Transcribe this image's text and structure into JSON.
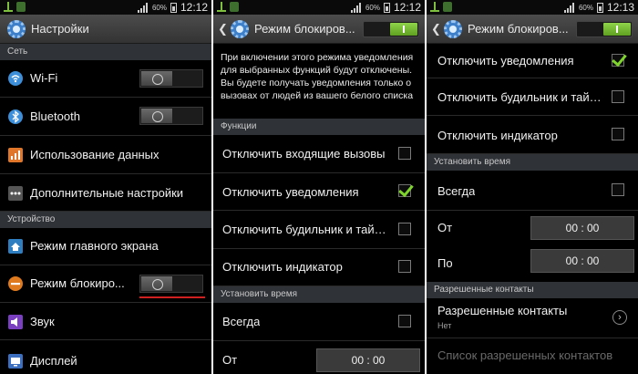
{
  "status": {
    "screen1": {
      "battery": "60%",
      "time": "12:12"
    },
    "screen2": {
      "battery": "60%",
      "time": "12:12"
    },
    "screen3": {
      "battery": "60%",
      "time": "12:13"
    }
  },
  "screen1": {
    "title": "Настройки",
    "section_network": "Сеть",
    "wifi_label": "Wi-Fi",
    "bluetooth_label": "Bluetooth",
    "data_usage_label": "Использование данных",
    "more_settings_label": "Дополнительные настройки",
    "section_device": "Устройство",
    "home_screen_label": "Режим главного экрана",
    "blocking_mode_label": "Режим блокиро...",
    "sound_label": "Звук",
    "display_label": "Дисплей",
    "toggles": {
      "wifi": false,
      "bluetooth": false,
      "blocking_mode": false
    }
  },
  "screen2": {
    "title": "Режим блокиров...",
    "description": "При включении этого режима уведомления для выбранных функций будут отключены. Вы будете получать уведомления только о вызовах от людей из вашего белого списка",
    "section_functions": "Функции",
    "opt_incoming_calls": "Отключить входящие вызовы",
    "opt_notifications": "Отключить уведомления",
    "opt_alarm": "Отключить будильник и таймер",
    "opt_indicator": "Отключить индикатор",
    "section_time": "Установить время",
    "always_label": "Всегда",
    "from_label": "От",
    "from_value": "00 : 00",
    "checked": {
      "incoming_calls": false,
      "notifications": true,
      "alarm": false,
      "indicator": false,
      "always": false
    }
  },
  "screen3": {
    "title": "Режим блокиров...",
    "opt_notifications": "Отключить уведомления",
    "opt_alarm": "Отключить будильник и таймер",
    "opt_indicator": "Отключить индикатор",
    "section_time": "Установить время",
    "always_label": "Всегда",
    "from_label": "От",
    "from_value": "00 : 00",
    "to_label": "По",
    "to_value": "00 : 00",
    "section_contacts": "Разрешенные контакты",
    "allowed_contacts_label": "Разрешенные контакты",
    "allowed_contacts_value": "Нет",
    "allowed_list_label": "Список разрешенных контактов",
    "checked": {
      "notifications": true,
      "alarm": false,
      "indicator": false,
      "always": false
    }
  },
  "colors": {
    "accent_green": "#7ed32c",
    "header_bg": "#2f3237",
    "red_underline": "#d02020"
  }
}
